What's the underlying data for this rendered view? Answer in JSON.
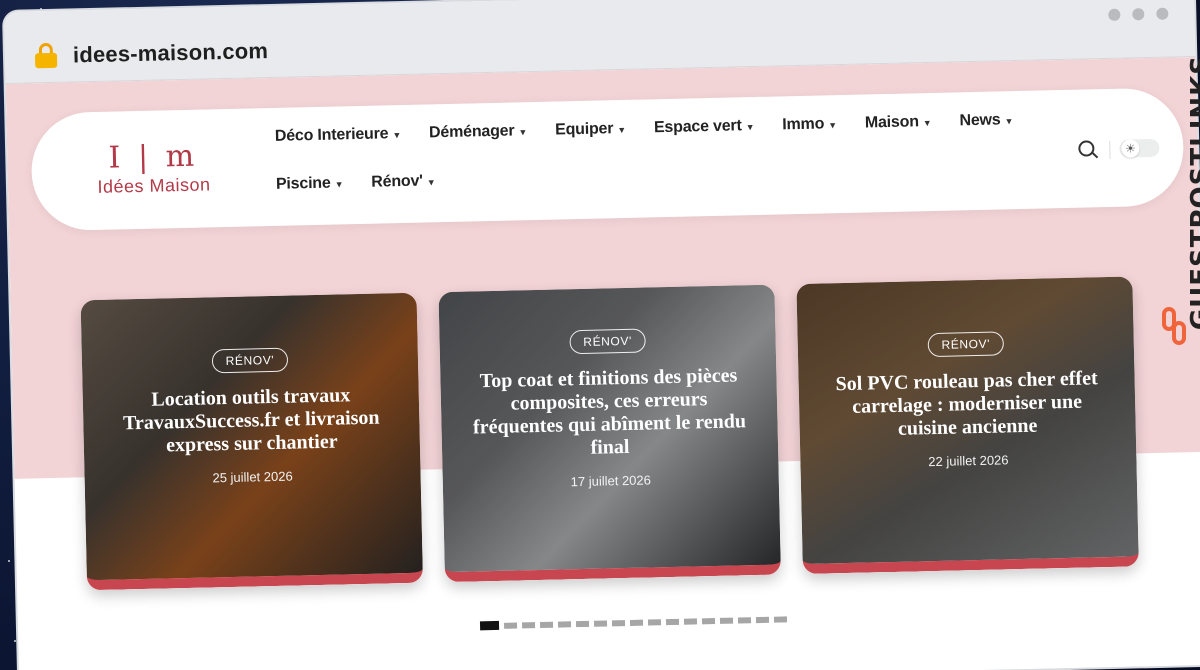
{
  "browser": {
    "url": "idees-maison.com"
  },
  "site": {
    "logo_mark": "I | m",
    "logo_text": "Idées Maison"
  },
  "nav": {
    "items": [
      {
        "label": "Déco Interieure"
      },
      {
        "label": "Déménager"
      },
      {
        "label": "Equiper"
      },
      {
        "label": "Espace vert"
      },
      {
        "label": "Immo"
      },
      {
        "label": "Maison"
      },
      {
        "label": "News"
      },
      {
        "label": "Piscine"
      },
      {
        "label": "Rénov'"
      }
    ],
    "dropdown_icon": "chevron-down-icon",
    "search_icon": "search-icon",
    "theme_icon": "sun-icon"
  },
  "slider": {
    "cards": [
      {
        "category": "RÉNOV'",
        "title": "Location outils travaux TravauxSuccess.fr et livraison express sur chantier",
        "date": "25 juillet 2026"
      },
      {
        "category": "RÉNOV'",
        "title": "Top coat et finitions des pièces composites, ces erreurs fréquentes qui abîment le rendu final",
        "date": "17 juillet 2026"
      },
      {
        "category": "RÉNOV'",
        "title": "Sol PVC rouleau pas cher effet carrelage : moderniser une cuisine ancienne",
        "date": "22 juillet 2026"
      }
    ],
    "page_count": 17,
    "active_page": 1
  },
  "watermark": {
    "text": "GUESTPOSTLINKS",
    "icon": "link-icon"
  },
  "colors": {
    "accent": "#c8464f",
    "hero_band": "#f2d3d6",
    "brand_red": "#b23a48",
    "watermark_orange": "#f0643c"
  }
}
